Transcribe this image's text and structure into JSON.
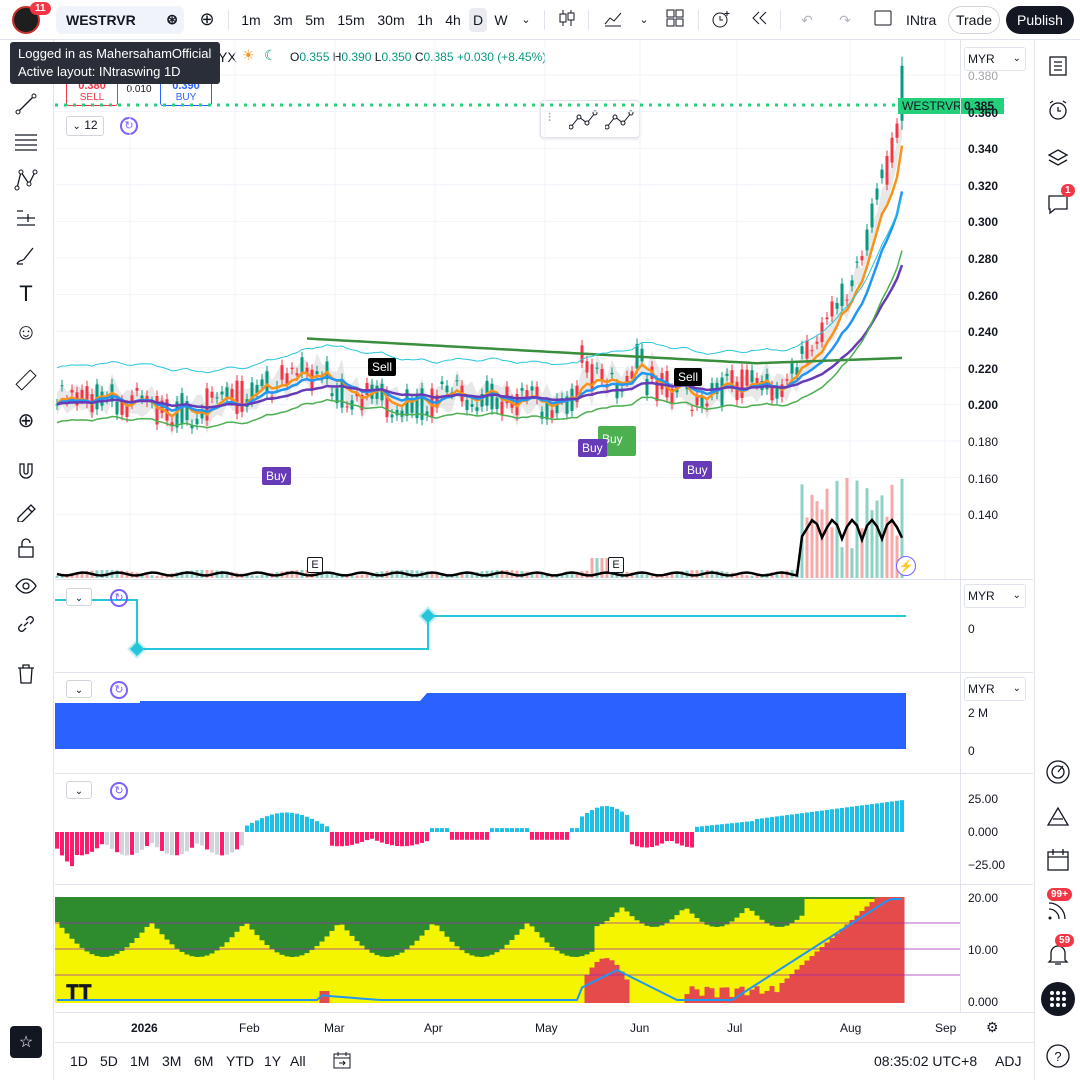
{
  "topbar": {
    "notification_count": "11",
    "symbol": "WESTRVR",
    "intervals": [
      "1m",
      "3m",
      "5m",
      "15m",
      "30m",
      "1h",
      "4h",
      "D",
      "W"
    ],
    "active_interval": "D",
    "layout_name": "INtra",
    "trade_label": "Trade",
    "publish_label": "Publish"
  },
  "tooltip": {
    "line1": "Logged in as MahersahamOfficial",
    "line2": "Active layout: INtraswing 1D"
  },
  "legend": {
    "symbol_suffix": "YX",
    "open_label": "O",
    "open": "0.355",
    "high_label": "H",
    "high": "0.390",
    "low_label": "L",
    "low": "0.350",
    "close_label": "C",
    "close": "0.385",
    "change": "+0.030 (+8.45%)",
    "sell_price": "0.380",
    "sell_label": "SELL",
    "spread": "0.010",
    "buy_price": "0.390",
    "buy_label": "BUY",
    "indicator_count": "12"
  },
  "main_pane": {
    "currency": "MYR",
    "price_tag_symbol": "WESTRVR",
    "price_tag_value": "0.385",
    "price_axis": [
      "0.380",
      "0.360",
      "0.340",
      "0.320",
      "0.300",
      "0.280",
      "0.260",
      "0.240",
      "0.220",
      "0.200",
      "0.180",
      "0.160",
      "0.140"
    ],
    "signals": [
      {
        "label": "Sell",
        "type": "sell"
      },
      {
        "label": "Buy",
        "type": "buy"
      },
      {
        "label": "Buy",
        "type": "buy"
      },
      {
        "label": "Buy",
        "type": "buy-green"
      },
      {
        "label": "Sell",
        "type": "sell"
      },
      {
        "label": "Buy",
        "type": "buy"
      }
    ],
    "earnings_marker": "E"
  },
  "pane2": {
    "currency": "MYR",
    "axis": [
      "0"
    ]
  },
  "pane3": {
    "currency": "MYR",
    "axis": [
      "2 M",
      "0"
    ]
  },
  "pane4": {
    "axis": [
      "25.00",
      "0.000",
      "−25.00"
    ]
  },
  "pane5": {
    "axis": [
      "20.00",
      "10.00",
      "0.000"
    ]
  },
  "time_axis": [
    "2026",
    "Feb",
    "Mar",
    "Apr",
    "May",
    "Jun",
    "Jul",
    "Aug",
    "Sep"
  ],
  "bottombar": {
    "ranges": [
      "1D",
      "5D",
      "1M",
      "3M",
      "6M",
      "YTD",
      "1Y",
      "All"
    ],
    "clock": "08:35:02 UTC+8",
    "adj_label": "ADJ"
  },
  "right_sidebar": {
    "chat_badge": "1",
    "feed_badge": "99+",
    "alerts_badge": "59"
  },
  "colors": {
    "up": "#089981",
    "down": "#f23645",
    "accent": "#2962ff",
    "ema_orange": "#f7931a",
    "ema_blue": "#2196f3",
    "purple": "#673ab7",
    "green_line": "#388e3c",
    "cyan": "#26c6da"
  }
}
